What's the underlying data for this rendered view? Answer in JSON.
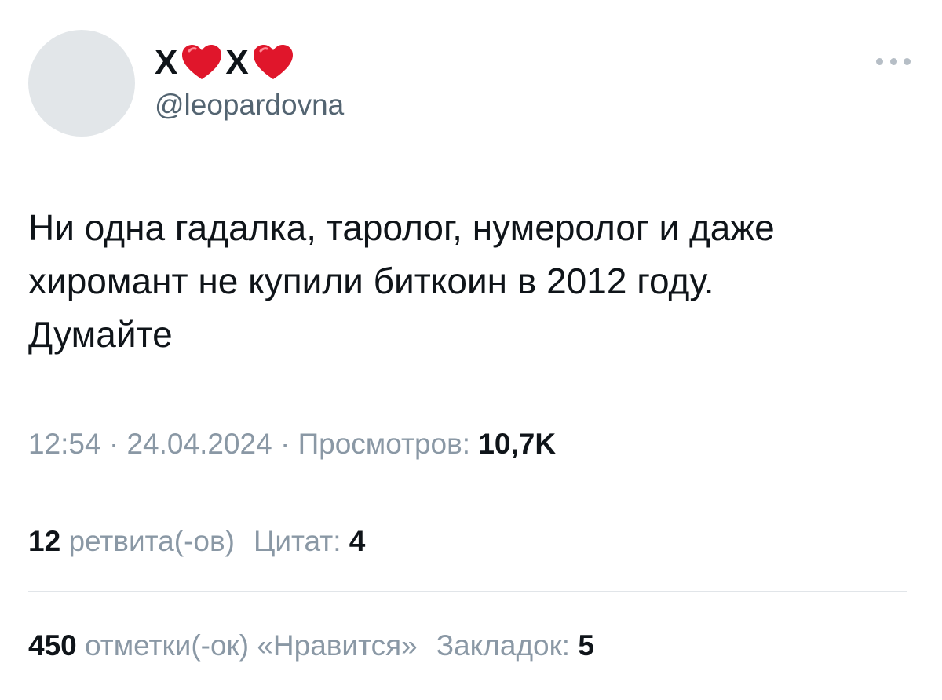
{
  "author": {
    "name_parts": [
      "X",
      "X"
    ],
    "handle": "@leopardovna"
  },
  "tweet": {
    "lines": [
      "Ни одна гадалка, таролог, нумеролог и даже",
      "хиромант не купили биткоин в 2012 году.",
      "Думайте"
    ]
  },
  "meta": {
    "time": "12:54",
    "separator": "·",
    "date": "24.04.2024",
    "views_label": "Просмотров:",
    "views_value": "10,7K"
  },
  "stats": {
    "retweets_count": "12",
    "retweets_label": "ретвита(-ов)",
    "quotes_label": "Цитат:",
    "quotes_count": "4",
    "likes_count": "450",
    "likes_label": "отметки(-ок) «Нравится»",
    "bookmarks_label": "Закладок:",
    "bookmarks_count": "5"
  },
  "icons": {
    "heart": "heart-emoji",
    "more": "more-dots-icon"
  },
  "colors": {
    "text": "#0f1419",
    "secondary": "#536471",
    "meta": "#8a98a5",
    "avatar": "#e2e6e9",
    "divider": "#e1e5e9",
    "heart": "#e0162b"
  }
}
